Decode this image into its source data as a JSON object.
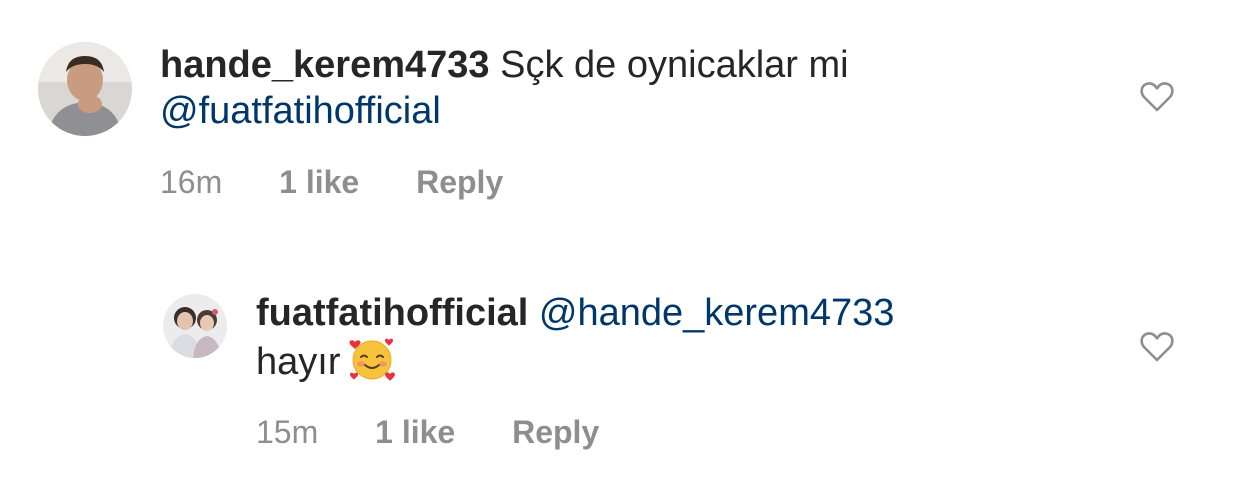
{
  "comments": [
    {
      "username": "hande_kerem4733",
      "text": "Sçk de oynicaklar mi",
      "mention": "@fuatfatihofficial",
      "time": "16m",
      "likes": "1 like",
      "reply_label": "Reply"
    },
    {
      "username": "fuatfatihofficial",
      "mention": "@hande_kerem4733",
      "text": "hayır",
      "emoji": "smiling-face-with-hearts",
      "time": "15m",
      "likes": "1 like",
      "reply_label": "Reply"
    }
  ],
  "icons": {
    "like": "heart-outline-icon"
  },
  "colors": {
    "username": "#262626",
    "mention": "#00376b",
    "meta": "#8e8e8e",
    "heart_stroke": "#8e8e8e"
  }
}
